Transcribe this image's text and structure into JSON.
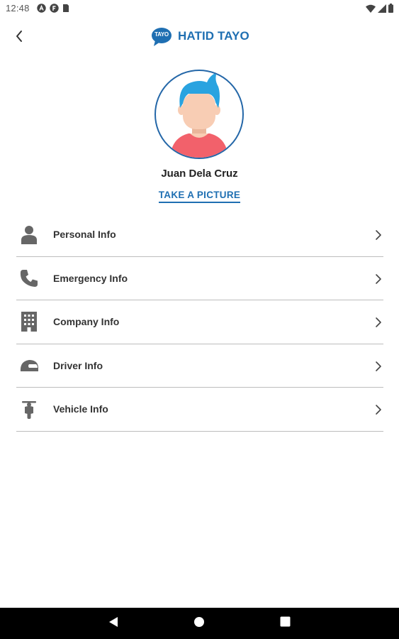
{
  "status_bar": {
    "time": "12:48",
    "left_icons": [
      "a-circle-icon",
      "f-circle-icon",
      "sim-card-icon"
    ],
    "right_icons": [
      "wifi-icon",
      "signal-icon",
      "battery-icon"
    ]
  },
  "header": {
    "back_icon": "chevron-left-icon",
    "logo_text": "TAYO",
    "app_name": "HATID TAYO"
  },
  "profile": {
    "name": "Juan Dela Cruz",
    "take_picture_label": "TAKE A PICTURE"
  },
  "menu": {
    "items": [
      {
        "label": "Personal Info",
        "icon": "person-icon"
      },
      {
        "label": "Emergency Info",
        "icon": "phone-icon"
      },
      {
        "label": "Company Info",
        "icon": "building-icon"
      },
      {
        "label": "Driver Info",
        "icon": "helmet-icon"
      },
      {
        "label": "Vehicle Info",
        "icon": "scooter-icon"
      }
    ]
  },
  "nav_bar": {
    "buttons": [
      "back-triangle-icon",
      "home-circle-icon",
      "recents-square-icon"
    ]
  },
  "colors": {
    "brand_blue": "#1f6fb2",
    "icon_gray": "#666666",
    "divider": "#bdbdbd",
    "avatar_hair": "#29a3e0",
    "avatar_shirt": "#f2616b",
    "avatar_skin": "#f8cdb4"
  }
}
